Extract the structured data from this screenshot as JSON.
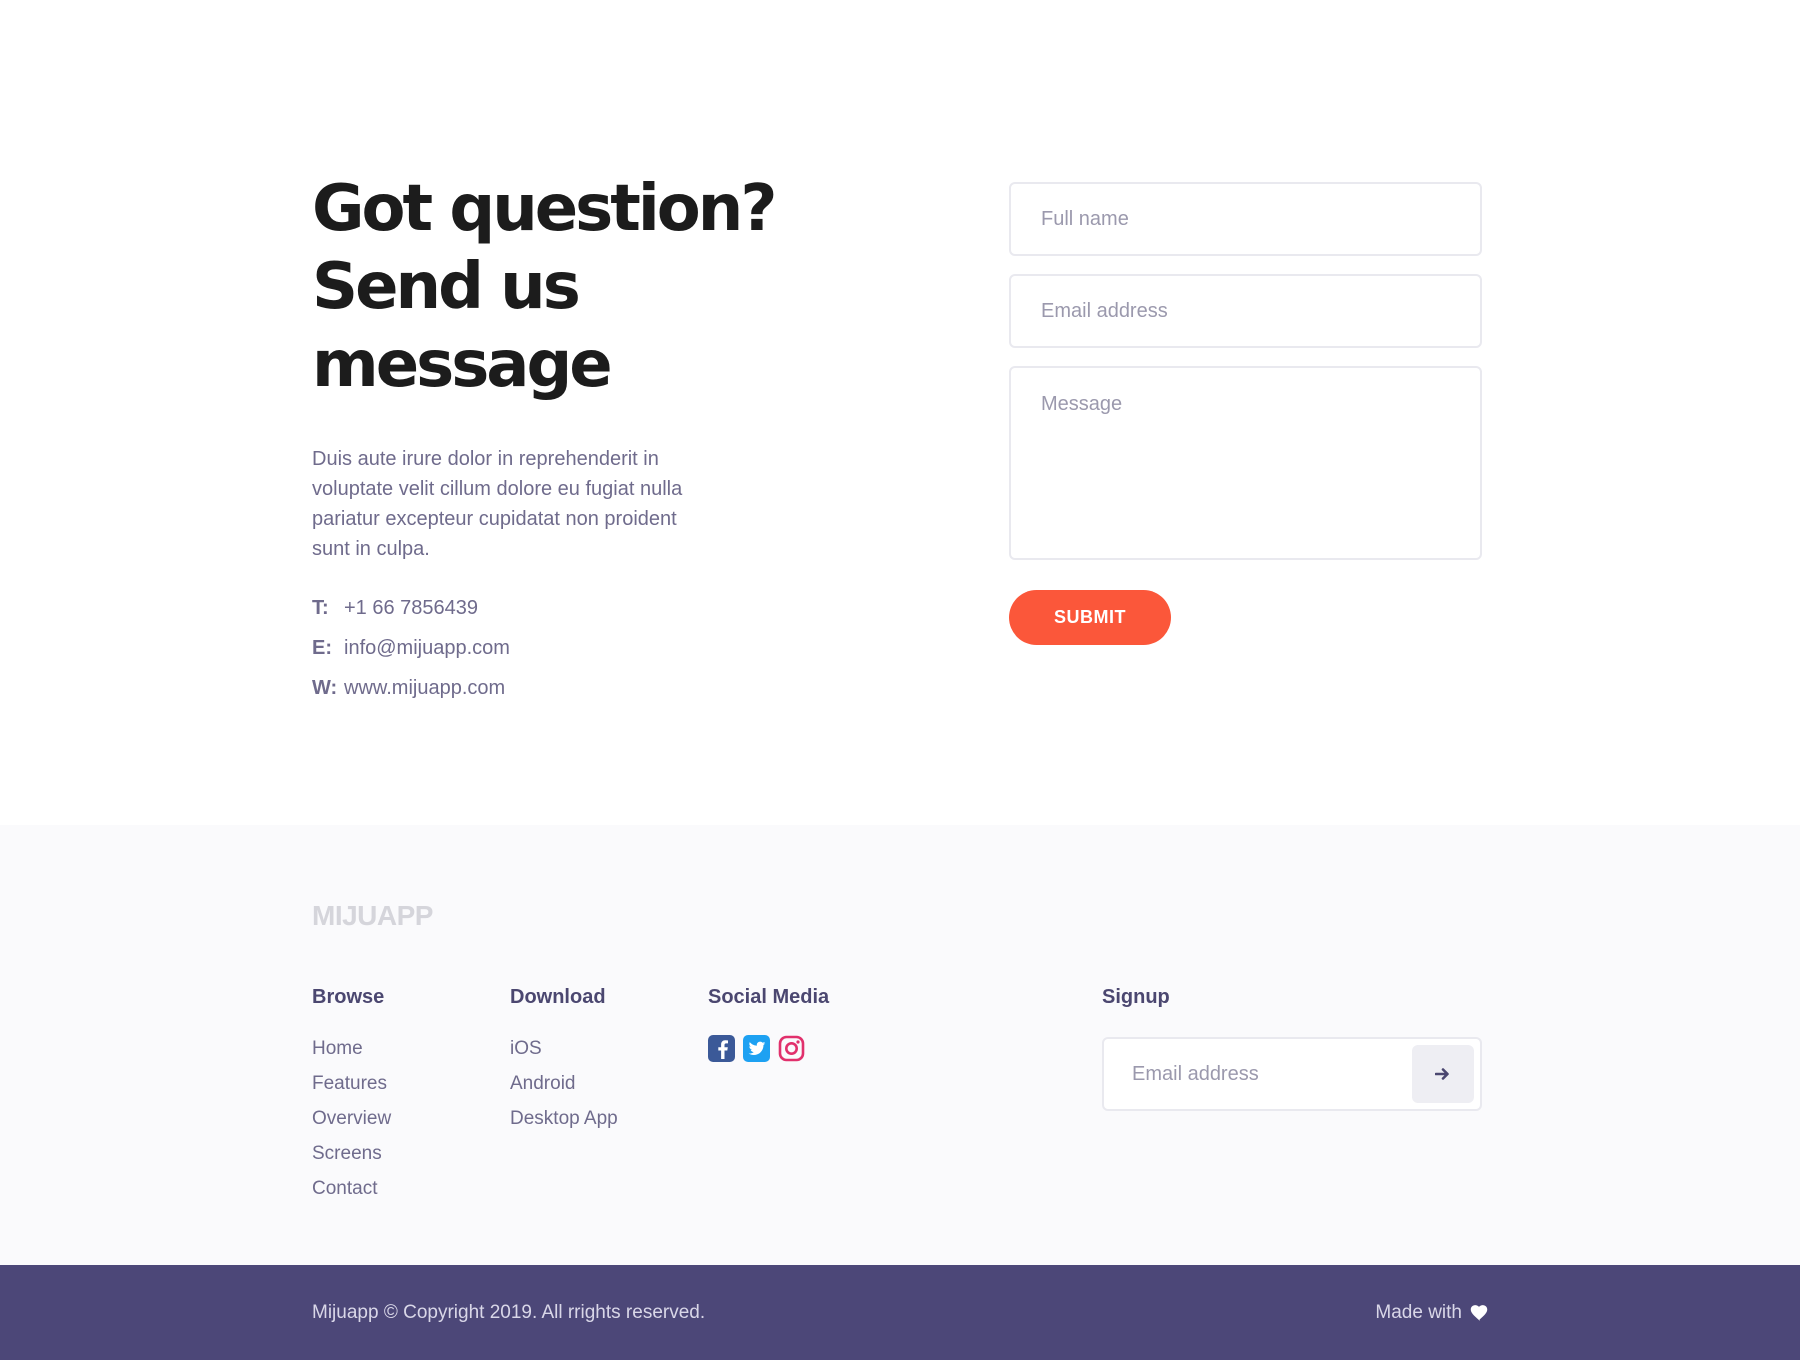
{
  "contact": {
    "headline_line1": "Got question?",
    "headline_line2": "Send us message",
    "intro": "Duis aute irure dolor in reprehenderit in voluptate velit cillum dolore eu fugiat nulla pariatur excepteur cupidatat non proident sunt in culpa.",
    "rows": [
      {
        "key": "T:",
        "value": "+1 66 7856439"
      },
      {
        "key": "E:",
        "value": "info@mijuapp.com"
      },
      {
        "key": "W:",
        "value": "www.mijuapp.com"
      }
    ]
  },
  "form": {
    "fullname_placeholder": "Full name",
    "email_placeholder": "Email address",
    "message_placeholder": "Message",
    "submit_label": "SUBMIT",
    "accent_color": "#fb573a"
  },
  "footer": {
    "brand": "MIJUAPP",
    "browse": {
      "title": "Browse",
      "items": [
        "Home",
        "Features",
        "Overview",
        "Screens",
        "Contact"
      ]
    },
    "download": {
      "title": "Download",
      "items": [
        "iOS",
        "Android",
        "Desktop App"
      ]
    },
    "social": {
      "title": "Social Media",
      "icons": [
        "facebook-icon",
        "twitter-icon",
        "instagram-icon"
      ]
    },
    "signup": {
      "title": "Signup",
      "email_placeholder": "Email address",
      "button_icon": "arrow-right-icon"
    }
  },
  "bottombar": {
    "copyright": "Mijuapp © Copyright 2019. All rrights reserved.",
    "made_with": "Made with",
    "heart_icon": "heart-icon",
    "background_color": "#4c4778"
  }
}
